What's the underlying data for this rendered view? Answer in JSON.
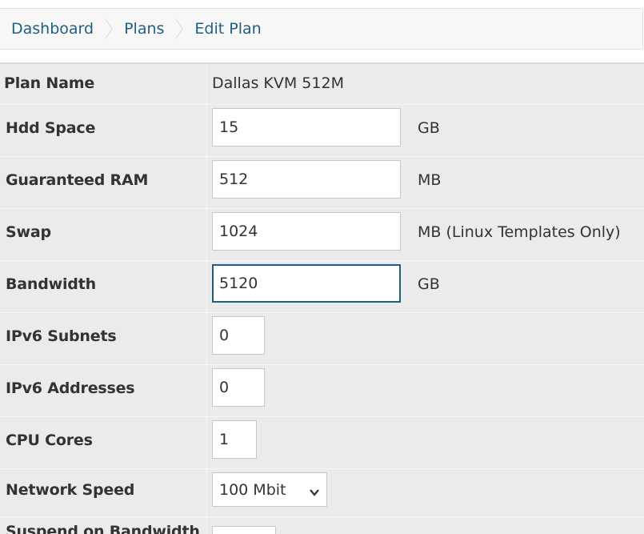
{
  "breadcrumb": {
    "items": [
      "Dashboard",
      "Plans",
      "Edit Plan"
    ]
  },
  "form": {
    "plan_name": {
      "label": "Plan Name",
      "value": "Dallas KVM 512M"
    },
    "hdd_space": {
      "label": "Hdd Space",
      "value": "15",
      "unit": "GB"
    },
    "guaranteed_ram": {
      "label": "Guaranteed RAM",
      "value": "512",
      "unit": "MB"
    },
    "swap": {
      "label": "Swap",
      "value": "1024",
      "unit": "MB (Linux Templates Only)"
    },
    "bandwidth": {
      "label": "Bandwidth",
      "value": "5120",
      "unit": "GB"
    },
    "ipv6_subnets": {
      "label": "IPv6 Subnets",
      "value": "0"
    },
    "ipv6_addresses": {
      "label": "IPv6 Addresses",
      "value": "0"
    },
    "cpu_cores": {
      "label": "CPU Cores",
      "value": "1"
    },
    "network_speed": {
      "label": "Network Speed",
      "selected": "100 Mbit"
    },
    "suspend_on_bandwidth": {
      "label": "Suspend on Bandwidth"
    }
  },
  "colors": {
    "link": "#1f5f80",
    "form_background": "#ebebeb",
    "focus_border": "#1f5f80"
  },
  "icons": {
    "breadcrumb_separator": "chevron-right-icon",
    "select_arrow": "chevron-down-icon"
  }
}
